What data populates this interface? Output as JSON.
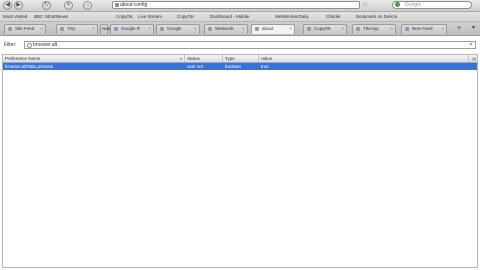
{
  "toolbar": {
    "back_glyph": "◀",
    "forward_glyph": "▶",
    "reload_glyph": "↻",
    "stop_glyph": "✕",
    "home_glyph": "⌂",
    "url": "about:config",
    "bookmark_star": "☆",
    "search_placeholder": "Google"
  },
  "bookmarks": [
    {
      "label": "Most Visited"
    },
    {
      "label": "BBC NEWS"
    },
    {
      "label": "News"
    },
    {
      "label": "CopyOK"
    },
    {
      "label": "Live Stream"
    },
    {
      "label": "CopyOK"
    },
    {
      "label": "Dashboard - Mobile"
    },
    {
      "label": "WebWorkerDaily"
    },
    {
      "label": "Gfinder"
    },
    {
      "label": "Bookmark on Delicio"
    }
  ],
  "tabs": [
    {
      "label": "Site Feed"
    },
    {
      "label": "Tiny"
    },
    {
      "label": "News"
    },
    {
      "label": "Google R"
    },
    {
      "label": "Google"
    },
    {
      "label": "Webwork"
    },
    {
      "label": "about"
    },
    {
      "label": "CopyOK"
    },
    {
      "label": "TheApp"
    },
    {
      "label": "New Feed"
    }
  ],
  "tab_add": "+",
  "tab_list": "▾",
  "filter": {
    "label": "Filter:",
    "value": "browser.alt",
    "clear": "✕"
  },
  "table": {
    "headers": [
      "Preference Name",
      "Status",
      "Type",
      "Value"
    ],
    "rows": [
      {
        "name": "browser.altTabs.preview",
        "status": "user set",
        "type": "boolean",
        "value": "true"
      }
    ]
  },
  "colors": {
    "selection": "#3b73d4"
  }
}
